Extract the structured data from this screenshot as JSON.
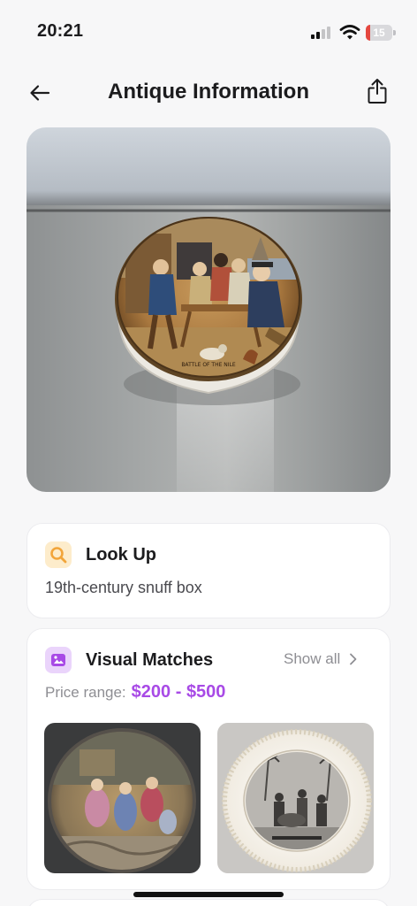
{
  "status_bar": {
    "time": "20:21",
    "battery_level": "15",
    "battery_color": "#e5473f",
    "signal_bars_active": 2,
    "signal_bars_total": 4
  },
  "nav": {
    "title": "Antique Information",
    "back_icon": "arrow-left-icon",
    "share_icon": "share-icon"
  },
  "hero": {
    "icon": "antique-photo",
    "inscription": "BATTLE OF THE NILE"
  },
  "lookup": {
    "title": "Look Up",
    "text": "19th-century snuff box",
    "icon": "search-icon",
    "icon_color": "#f2a53a"
  },
  "visual_matches": {
    "title": "Visual Matches",
    "show_all_label": "Show all",
    "price_label": "Price range:",
    "price_value": "$200 - $500",
    "accent_color": "#a84ae6",
    "icon": "gallery-icon",
    "thumbnails": [
      {
        "icon": "match-image"
      },
      {
        "icon": "match-image"
      }
    ]
  }
}
